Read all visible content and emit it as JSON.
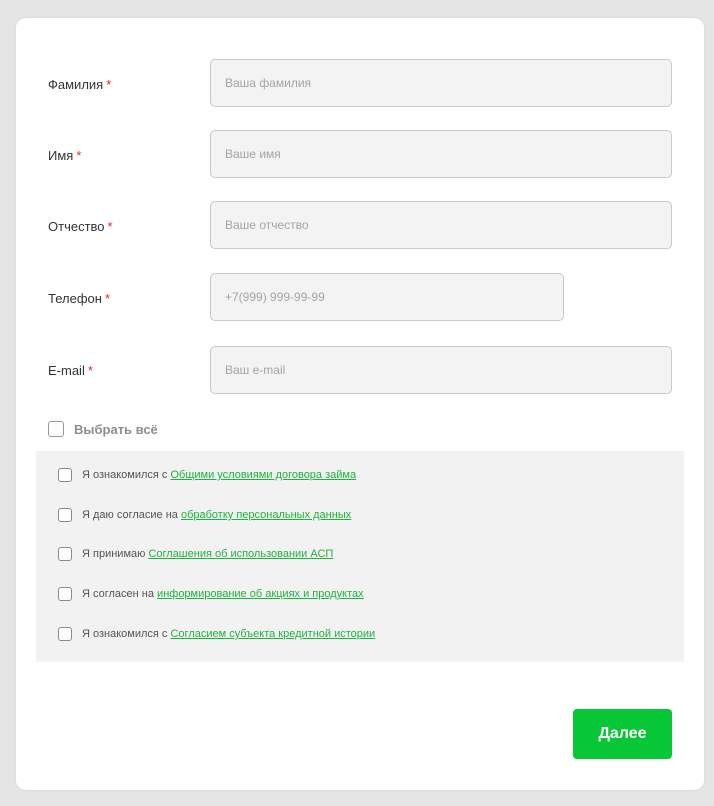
{
  "form": {
    "fields": [
      {
        "label": "Фамилия",
        "required_mark": "*",
        "placeholder": "Ваша фамилия",
        "value": ""
      },
      {
        "label": "Имя",
        "required_mark": "*",
        "placeholder": "Ваше имя",
        "value": ""
      },
      {
        "label": "Отчество",
        "required_mark": "*",
        "placeholder": "Ваше отчество",
        "value": ""
      },
      {
        "label": "Телефон",
        "required_mark": "*",
        "placeholder": "+7(999) 999-99-99",
        "value": ""
      },
      {
        "label": "E-mail",
        "required_mark": "*",
        "placeholder": "Ваш e-mail",
        "value": ""
      }
    ],
    "select_all_label": "Выбрать всё",
    "agreements": [
      {
        "prefix": "Я ознакомился с ",
        "link": "Общими условиями договора займа",
        "checked": false
      },
      {
        "prefix": "Я даю согласие на ",
        "link": "обработку персональных данных",
        "checked": false
      },
      {
        "prefix": "Я принимаю ",
        "link": "Соглашения об использовании АСП",
        "checked": false
      },
      {
        "prefix": "Я согласен на ",
        "link": "информирование об акциях и продуктах",
        "checked": false
      },
      {
        "prefix": "Я ознакомился с ",
        "link": "Согласием субъекта кредитной истории",
        "checked": false
      }
    ],
    "submit_label": "Далее"
  },
  "colors": {
    "accent_green": "#07c737",
    "link_green": "#1bb43b",
    "required_red": "#e52626",
    "input_bg": "#f3f3f3",
    "agreements_bg": "#f2f2f2"
  }
}
